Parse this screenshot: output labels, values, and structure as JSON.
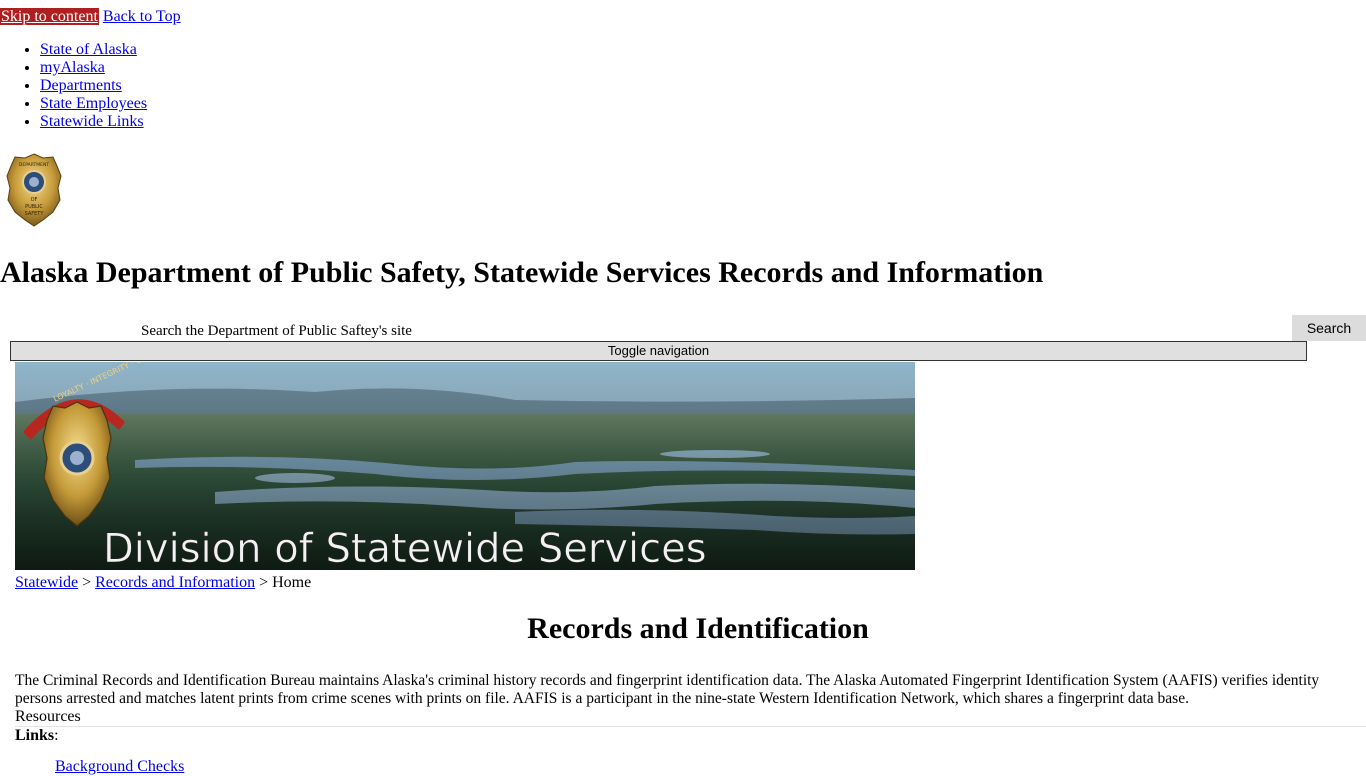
{
  "skip_nav": {
    "skip_label": "Skip to content",
    "back_label": "Back to Top"
  },
  "top_nav": {
    "items": [
      {
        "label": "State of Alaska"
      },
      {
        "label": "myAlaska"
      },
      {
        "label": "Departments"
      },
      {
        "label": "State Employees"
      },
      {
        "label": "Statewide Links"
      }
    ]
  },
  "header": {
    "logo_text": [
      "DEPARTMENT",
      "OF",
      "PUBLIC",
      "SAFETY"
    ],
    "title": "Alaska Department of Public Safety, Statewide Services Records and Information"
  },
  "search": {
    "value": "Search the Department of Public Saftey's site",
    "button_label": "Search"
  },
  "toggle_nav": {
    "label": "Toggle navigation"
  },
  "banner": {
    "caption": "Division of Statewide Services",
    "ribbon_text": "LOYALTY · INTEGRITY · COURAGE"
  },
  "breadcrumb": {
    "items": [
      "Statewide",
      "Records and Information",
      "Home"
    ],
    "separator": ">"
  },
  "main": {
    "heading": "Records and Identification",
    "intro": "The Criminal Records and Identification Bureau maintains Alaska's criminal history records and fingerprint identification data. The Alaska Automated Fingerprint Identification System (AAFIS) verifies identity persons arrested and matches latent prints from crime scenes with prints on file. AAFIS is a participant in the nine-state Western Identification Network, which shares a fingerprint data base.",
    "resources_label": "Resources",
    "links_label": "Links",
    "links_colon": ":",
    "links": [
      {
        "label": "Background Checks"
      }
    ]
  },
  "colors": {
    "link": "#0000ee",
    "skip_bg": "#b01f1f",
    "button_bg": "#dcdcdc"
  }
}
